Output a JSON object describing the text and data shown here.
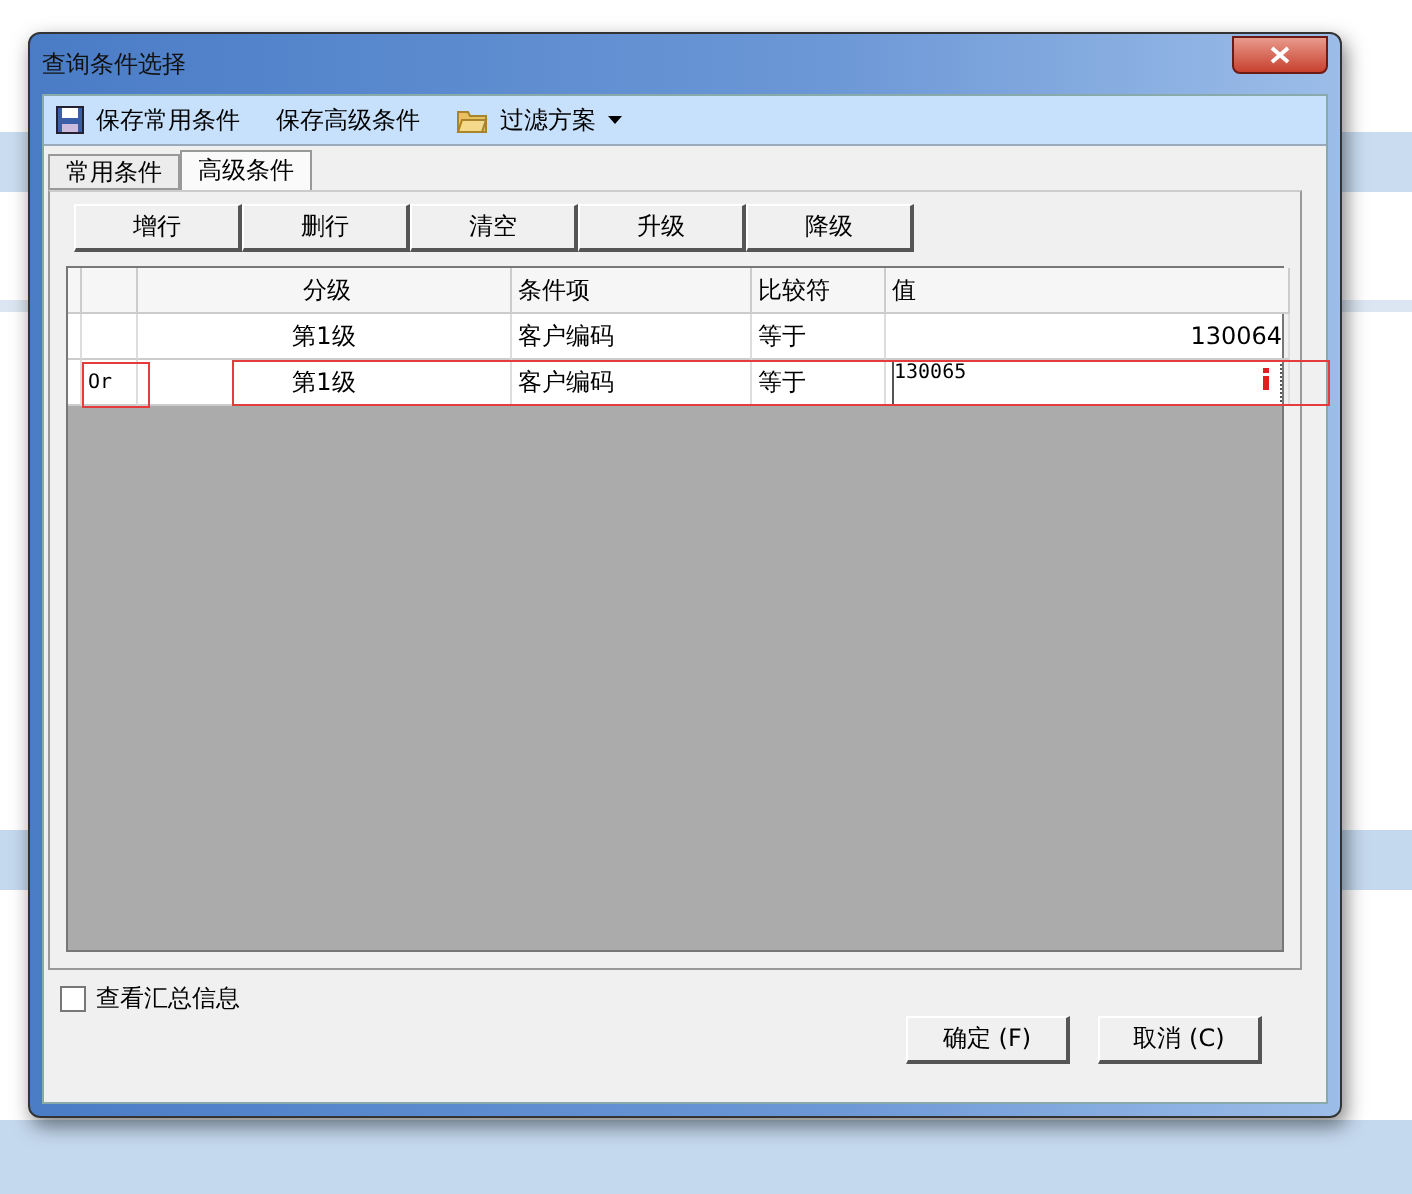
{
  "window": {
    "title": "查询条件选择"
  },
  "toolbar": [
    {
      "label": "保存常用条件",
      "dropdown": false
    },
    {
      "label": "保存高级条件",
      "dropdown": false
    },
    {
      "label": "过滤方案",
      "dropdown": true
    }
  ],
  "tabs": [
    {
      "label": "常用条件",
      "selected": false
    },
    {
      "label": "高级条件",
      "selected": true
    }
  ],
  "actions": [
    "增行",
    "删行",
    "清空",
    "升级",
    "降级"
  ],
  "table": {
    "columns": [
      "分级",
      "条件项",
      "比较符",
      "值"
    ],
    "rows": [
      {
        "logic": "",
        "grade": "第1级",
        "item": "客户编码",
        "operator": "等于",
        "value": "130064",
        "editing": false,
        "highlighted": false
      },
      {
        "logic": "Or",
        "grade": "第1级",
        "item": "客户编码",
        "operator": "等于",
        "value": "130065",
        "editing": true,
        "highlighted": true
      }
    ]
  },
  "summary": {
    "label": "查看汇总信息",
    "checked": false
  },
  "buttons": [
    "确定 (F)",
    "取消 (C)"
  ]
}
